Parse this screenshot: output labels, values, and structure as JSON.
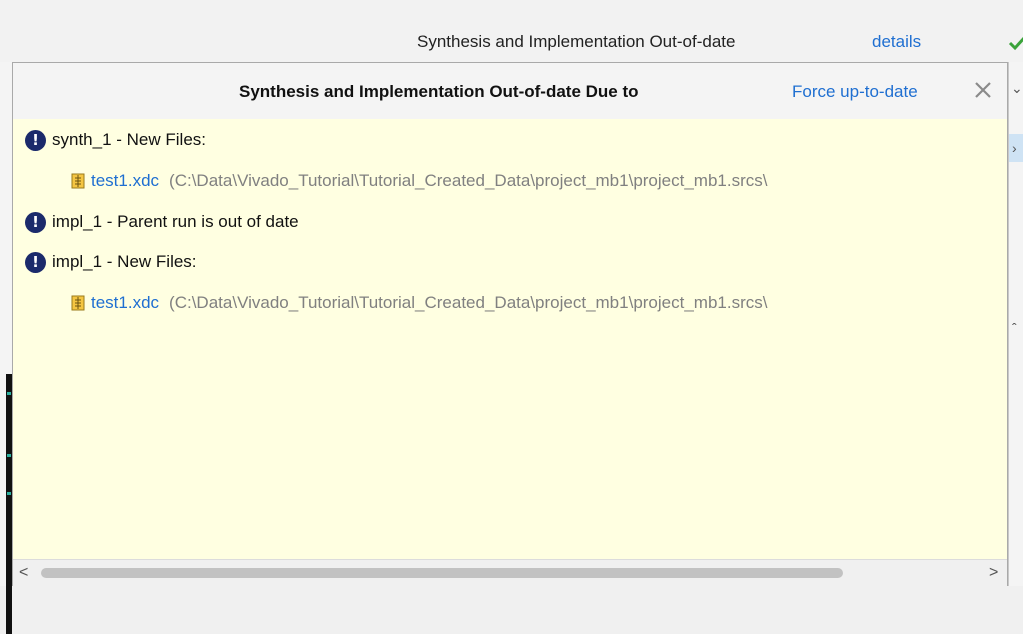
{
  "statusbar": {
    "status_text": "Synthesis and Implementation Out-of-date",
    "details_label": "details",
    "check_color": "#3aa33a"
  },
  "popup": {
    "title": "Synthesis and Implementation Out-of-date Due to",
    "force_label": "Force up-to-date",
    "close_symbol": "✕",
    "issues": [
      {
        "icon": "alert-icon",
        "text": "synth_1 - New Files:"
      },
      {
        "icon": "alert-icon",
        "text": "impl_1 - Parent run is out of date"
      },
      {
        "icon": "alert-icon",
        "text": "impl_1 - New Files:"
      }
    ],
    "files": [
      {
        "name": "test1.xdc",
        "path": "(C:\\Data\\Vivado_Tutorial\\Tutorial_Created_Data\\project_mb1\\project_mb1.srcs\\"
      },
      {
        "name": "test1.xdc",
        "path": "(C:\\Data\\Vivado_Tutorial\\Tutorial_Created_Data\\project_mb1\\project_mb1.srcs\\"
      }
    ]
  },
  "scrollbar": {
    "left_arrow": "<",
    "right_arrow": ">"
  },
  "colors": {
    "link": "#1f6fd1",
    "popup_bg": "#ffffe1",
    "alert": "#1b2a6b"
  }
}
